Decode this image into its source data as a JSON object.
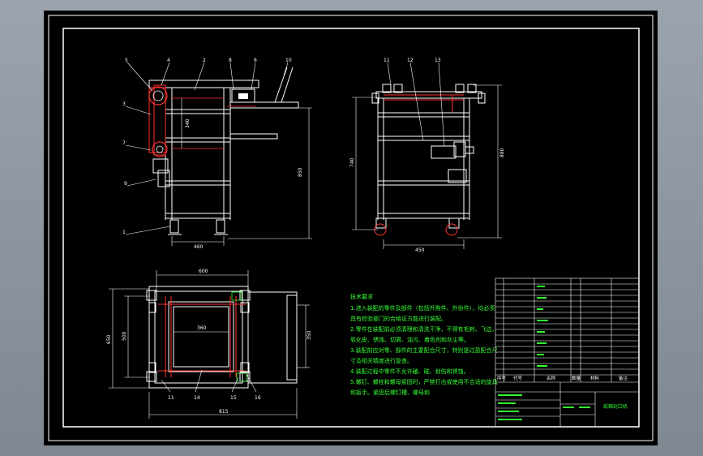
{
  "views": {
    "front": {
      "part_numbers": [
        "5",
        "4",
        "2",
        "8",
        "6",
        "10",
        "3",
        "7",
        "9",
        "1"
      ],
      "dimensions": {
        "width_bottom": "460",
        "height_total": "850",
        "pulley_span": "340"
      }
    },
    "side": {
      "part_numbers": [
        "11",
        "12",
        "13"
      ],
      "dimensions": {
        "width_bottom": "450",
        "height_left": "740",
        "height_right": "880"
      }
    },
    "top": {
      "part_numbers": [
        "11",
        "14",
        "15",
        "16"
      ],
      "dimensions": {
        "width_top": "600",
        "width_inner": "360",
        "width_bottom": "815",
        "height_outer": "650",
        "height_inner": "500",
        "height_right": "350"
      }
    }
  },
  "tech_notes": {
    "title": "技术要求",
    "lines": [
      "1.进入装配的零件及部件（包括外购件、外协件），均必须",
      "具有检验部门的合格证方能进行装配。",
      "2.零件在装配前必须清理和清洗干净，不得有毛刺、飞边、",
      "氧化皮、锈蚀、切屑、油污、着色剂和灰尘等。",
      "3.装配前应对零、部件的主要配合尺寸，特别是过盈配合尺",
      "寸及相关精度进行复查。",
      "4.装配过程中零件不允许磕、碰、划伤和锈蚀。",
      "5.螺钉、螺栓和螺母紧固时，严禁打击或使用不合适的旋具",
      "和扳手。紧固后螺钉槽、螺母和"
    ]
  },
  "title_block": {
    "drawing_title": "纸箱封口机",
    "header_labels": [
      "序号",
      "代号",
      "名称",
      "数量",
      "材料",
      "备注"
    ]
  }
}
